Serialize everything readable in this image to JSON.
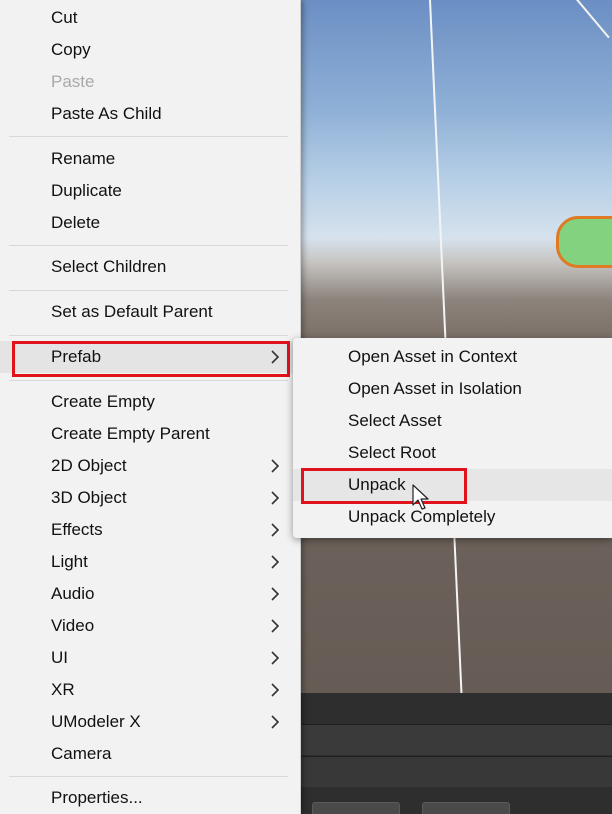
{
  "context_menu": {
    "items": [
      {
        "label": "Cut"
      },
      {
        "label": "Copy"
      },
      {
        "label": "Paste"
      },
      {
        "label": "Paste As Child"
      },
      {
        "label": "Rename"
      },
      {
        "label": "Duplicate"
      },
      {
        "label": "Delete"
      },
      {
        "label": "Select Children"
      },
      {
        "label": "Set as Default Parent"
      },
      {
        "label": "Prefab"
      },
      {
        "label": "Create Empty"
      },
      {
        "label": "Create Empty Parent"
      },
      {
        "label": "2D Object"
      },
      {
        "label": "3D Object"
      },
      {
        "label": "Effects"
      },
      {
        "label": "Light"
      },
      {
        "label": "Audio"
      },
      {
        "label": "Video"
      },
      {
        "label": "UI"
      },
      {
        "label": "XR"
      },
      {
        "label": "UModeler X"
      },
      {
        "label": "Camera"
      },
      {
        "label": "Properties..."
      }
    ],
    "disabled_item": "Paste",
    "highlighted_item": "Prefab"
  },
  "prefab_submenu": {
    "items": [
      {
        "label": "Open Asset in Context"
      },
      {
        "label": "Open Asset in Isolation"
      },
      {
        "label": "Select Asset"
      },
      {
        "label": "Select Root"
      },
      {
        "label": "Unpack"
      },
      {
        "label": "Unpack Completely"
      }
    ],
    "hovered_item": "Unpack",
    "highlighted_item": "Unpack"
  },
  "icons": {
    "submenu_arrow": "chevron-right-icon",
    "cursor": "mouse-pointer-icon"
  },
  "colors": {
    "menu_background": "#f2f2f2",
    "highlight_border": "#e0121b",
    "disabled_text": "#a9a9a9"
  }
}
